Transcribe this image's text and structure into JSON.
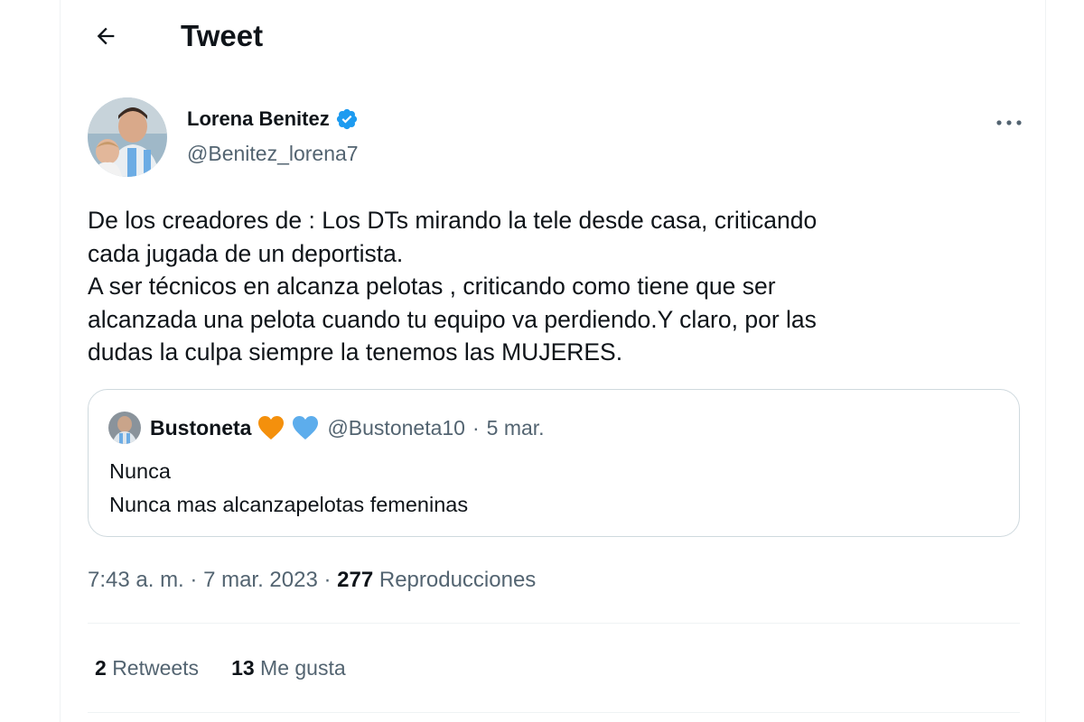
{
  "header": {
    "title": "Tweet",
    "back_icon": "arrow-left-icon"
  },
  "author": {
    "display_name": "Lorena Benitez",
    "handle": "@Benitez_lorena7",
    "verified": true,
    "verified_color": "#1d9bf0"
  },
  "tweet": {
    "lines": [
      "De los creadores de : Los DTs mirando la tele desde casa, criticando",
      "cada jugada de un deportista.",
      "A ser técnicos en alcanza pelotas , criticando como tiene que ser",
      "alcanzada una pelota cuando tu equipo va perdiendo.Y claro, por las",
      "dudas la culpa siempre la tenemos las MUJERES."
    ]
  },
  "quote": {
    "display_name": "Bustoneta",
    "emojis": [
      "orange-heart-icon",
      "blue-heart-icon"
    ],
    "handle": "@Bustoneta10",
    "separator": "·",
    "date": "5 mar.",
    "lines": [
      "Nunca",
      "Nunca mas alcanzapelotas femeninas"
    ]
  },
  "meta": {
    "time": "7:43 a. m.",
    "separator": " · ",
    "date": "7 mar. 2023",
    "views_count": "277",
    "views_label": "Reproducciones"
  },
  "stats": {
    "retweets_count": "2",
    "retweets_label": "Retweets",
    "likes_count": "13",
    "likes_label": "Me gusta"
  },
  "colors": {
    "text": "#0f1419",
    "secondary": "#536471",
    "border": "#cfd9de",
    "divider": "#eff3f4",
    "accent": "#1d9bf0",
    "orange_heart": "#f4900c",
    "blue_heart": "#5dadec"
  }
}
